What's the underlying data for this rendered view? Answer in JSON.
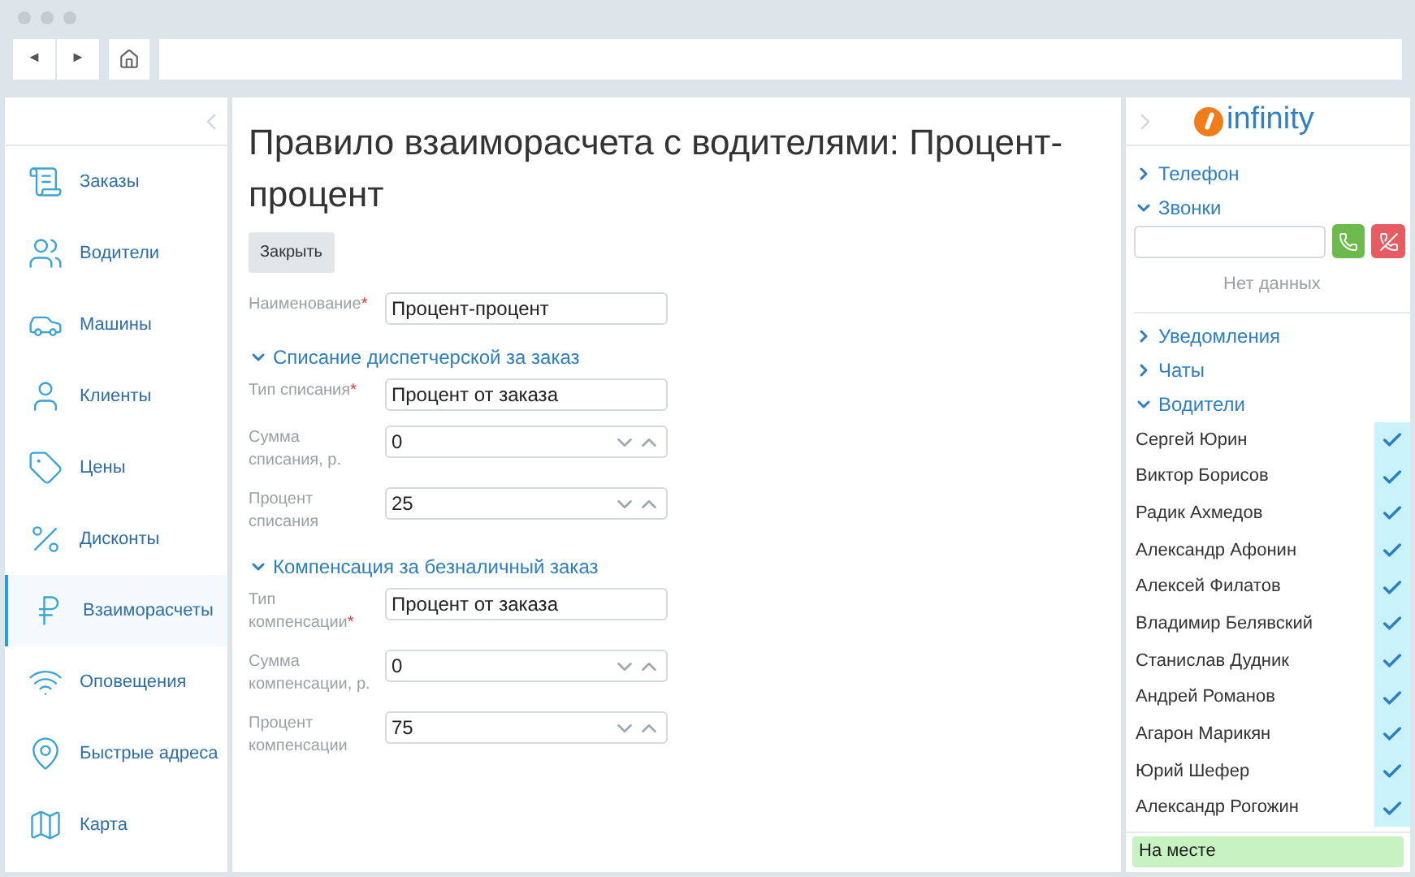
{
  "nav": {
    "back": "◄",
    "forward": "►"
  },
  "sidebar": {
    "items": [
      {
        "label": "Заказы",
        "selected": false
      },
      {
        "label": "Водители",
        "selected": false
      },
      {
        "label": "Машины",
        "selected": false
      },
      {
        "label": "Клиенты",
        "selected": false
      },
      {
        "label": "Цены",
        "selected": false
      },
      {
        "label": "Дисконты",
        "selected": false
      },
      {
        "label": "Взаиморасчеты",
        "selected": true
      },
      {
        "label": "Оповещения",
        "selected": false
      },
      {
        "label": "Быстрые адреса",
        "selected": false
      },
      {
        "label": "Карта",
        "selected": false
      }
    ]
  },
  "main": {
    "title": "Правило взаиморасчета с водителями: Процент-процент",
    "close_button": "Закрыть",
    "required_mark": "*",
    "name_field": {
      "label": "Наименование",
      "required": true,
      "value": "Процент-процент"
    },
    "sections": [
      {
        "title": "Списание диспетчерской за заказ",
        "expanded": true,
        "fields": [
          {
            "kind": "text",
            "label": "Тип списания",
            "required": true,
            "value": "Процент от заказа"
          },
          {
            "kind": "number",
            "label": "Сумма списания, р.",
            "required": false,
            "value": "0"
          },
          {
            "kind": "number",
            "label": "Процент списания",
            "required": false,
            "value": "25"
          }
        ]
      },
      {
        "title": "Компенсация за безналичный заказ",
        "expanded": true,
        "fields": [
          {
            "kind": "text",
            "label": "Тип компенсации",
            "required": true,
            "value": "Процент от заказа"
          },
          {
            "kind": "number",
            "label": "Сумма компенсации, р.",
            "required": false,
            "value": "0"
          },
          {
            "kind": "number",
            "label": "Процент компенсации",
            "required": false,
            "value": "75"
          }
        ]
      }
    ]
  },
  "right_panel": {
    "logo": "infinity",
    "phone": {
      "title": "Телефон",
      "expanded": false
    },
    "calls": {
      "title": "Звонки",
      "expanded": true,
      "empty": "Нет данных"
    },
    "notifications": {
      "title": "Уведомления",
      "expanded": false
    },
    "chats": {
      "title": "Чаты",
      "expanded": false
    },
    "drivers": {
      "title": "Водители",
      "expanded": true,
      "items": [
        {
          "name": "Сергей Юрин",
          "checked": true
        },
        {
          "name": "Виктор Борисов",
          "checked": true
        },
        {
          "name": "Радик Ахмедов",
          "checked": true
        },
        {
          "name": "Александр Афонин",
          "checked": true
        },
        {
          "name": "Алексей Филатов",
          "checked": true
        },
        {
          "name": "Владимир Белявский",
          "checked": true
        },
        {
          "name": "Станислав Дудник",
          "checked": true
        },
        {
          "name": "Андрей Романов",
          "checked": true
        },
        {
          "name": "Агарон Марикян",
          "checked": true
        },
        {
          "name": "Юрий Шефер",
          "checked": true
        },
        {
          "name": "Александр Рогожин",
          "checked": true
        }
      ]
    },
    "status": "На месте"
  }
}
